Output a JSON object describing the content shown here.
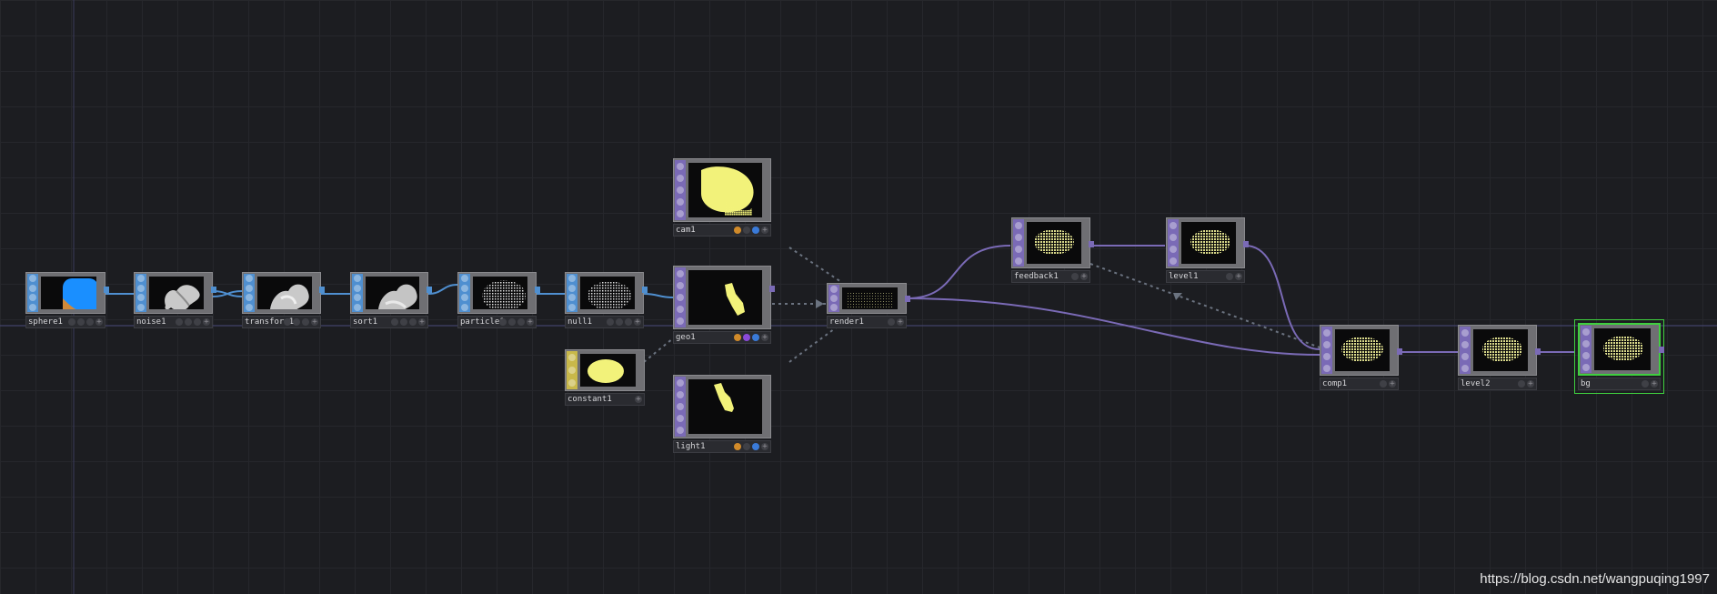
{
  "app": {
    "name": "TouchDesigner network editor"
  },
  "nodes": {
    "sphere1": {
      "label": "sphere1",
      "family": "SOP"
    },
    "noise1": {
      "label": "noise1",
      "family": "SOP"
    },
    "transform1": {
      "label": "transform1",
      "family": "SOP"
    },
    "sort1": {
      "label": "sort1",
      "family": "SOP"
    },
    "particle1": {
      "label": "particle1",
      "family": "SOP"
    },
    "null1": {
      "label": "null1",
      "family": "SOP"
    },
    "cam1": {
      "label": "cam1",
      "family": "COMP"
    },
    "geo1": {
      "label": "geo1",
      "family": "COMP"
    },
    "light1": {
      "label": "light1",
      "family": "COMP"
    },
    "constant1": {
      "label": "constant1",
      "family": "MAT"
    },
    "render1": {
      "label": "render1",
      "family": "TOP"
    },
    "feedback1": {
      "label": "feedback1",
      "family": "TOP"
    },
    "level1": {
      "label": "level1",
      "family": "TOP"
    },
    "comp1": {
      "label": "comp1",
      "family": "TOP"
    },
    "level2": {
      "label": "level2",
      "family": "TOP"
    },
    "bg": {
      "label": "bg",
      "family": "TOP",
      "selected": true
    }
  },
  "colors": {
    "background": "#1c1d21",
    "sop_wire": "#4f8fd0",
    "top_wire": "#7a6ab6",
    "reference_wire": "#6b7380",
    "selection": "#3fcf3f",
    "preview_yellow": "#f2f27a"
  },
  "watermark": "https://blog.csdn.net/wangpuqing1997"
}
